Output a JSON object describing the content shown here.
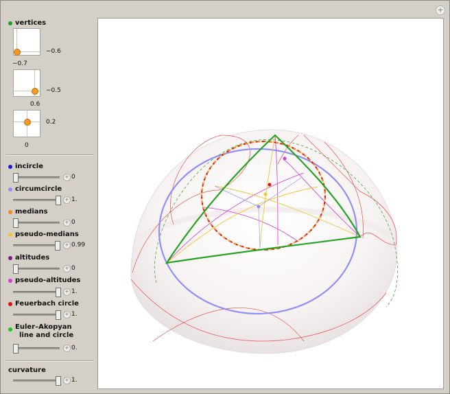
{
  "vertices": {
    "label": "vertices",
    "dot_color": "#1e9e1e",
    "pads": [
      {
        "value_right": "−0.6",
        "value_below": "−0.7"
      },
      {
        "value_right": "−0.5",
        "value_below": "0.6"
      },
      {
        "value_right": "0.2",
        "value_below": "0"
      }
    ]
  },
  "controls": [
    {
      "label": "incircle",
      "dot_color": "#1c1ccf",
      "value": "0",
      "level": 0.0
    },
    {
      "label": "circumcircle",
      "dot_color": "#8f8ff5",
      "value": "1.",
      "level": 1.0
    },
    {
      "label": "medians",
      "dot_color": "#f08a1c",
      "value": "0",
      "level": 0.0
    },
    {
      "label": "pseudo-medians",
      "dot_color": "#f4c430",
      "value": "0.99",
      "level": 0.99
    },
    {
      "label": "altitudes",
      "dot_color": "#7a1f8a",
      "value": "0",
      "level": 0.0
    },
    {
      "label": "pseudo-altitudes",
      "dot_color": "#d23ad2",
      "value": "1.",
      "level": 1.0
    },
    {
      "label": "Feuerbach circle",
      "dot_color": "#e01010",
      "value": "1.",
      "level": 1.0
    },
    {
      "label": "Euler–Akopyan line and circle",
      "label_line1": "Euler–Akopyan",
      "label_line2": "line and circle",
      "dot_color": "#22c322",
      "value": "0.",
      "level": 0.0
    }
  ],
  "curvature": {
    "label": "curvature",
    "value": "1.",
    "level": 1.0
  },
  "colors": {
    "triangle": "#22a322",
    "circumcircle": "#8f8ff5",
    "feuerbach": "#e01010",
    "pseudo_medians": "#f4c430",
    "pseudo_altitudes": "#d23ad2"
  }
}
